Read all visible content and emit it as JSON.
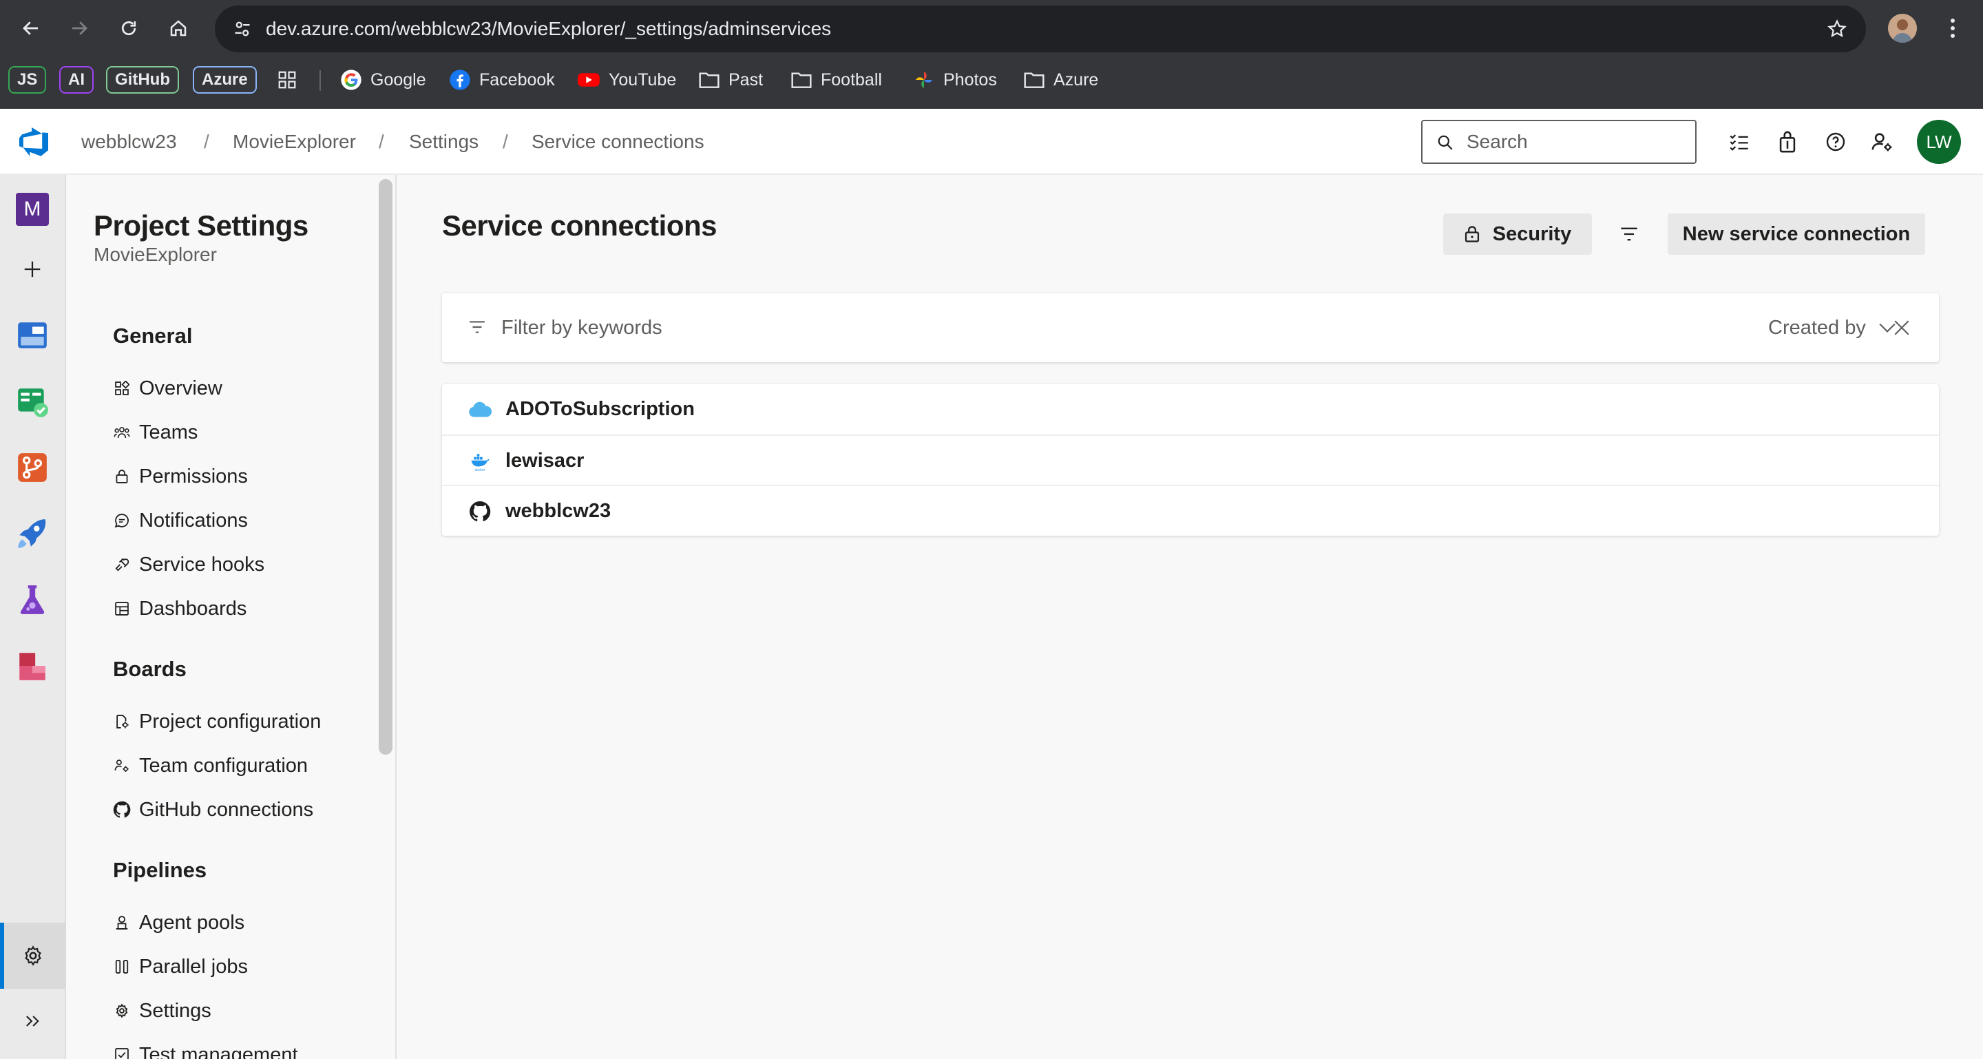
{
  "browser": {
    "url": "dev.azure.com/webblcw23/MovieExplorer/_settings/adminservices",
    "bookmarks": [
      {
        "label": "JS",
        "color": "#34a853"
      },
      {
        "label": "AI",
        "color": "#a142f4"
      },
      {
        "label": "GitHub",
        "color": "#81c995"
      },
      {
        "label": "Azure",
        "color": "#8ab4f8"
      }
    ],
    "links": [
      "Google",
      "Facebook",
      "YouTube",
      "Past",
      "Football",
      "Photos",
      "Azure"
    ]
  },
  "header": {
    "breadcrumbs": [
      "webblcw23",
      "MovieExplorer",
      "Settings",
      "Service connections"
    ],
    "breadcrumb_separator": "/",
    "search_placeholder": "Search",
    "avatar_initials": "LW"
  },
  "rail": {
    "project_initial": "M"
  },
  "settings_nav": {
    "title": "Project Settings",
    "subtitle": "MovieExplorer",
    "groups": [
      {
        "label": "General",
        "items": [
          "Overview",
          "Teams",
          "Permissions",
          "Notifications",
          "Service hooks",
          "Dashboards"
        ]
      },
      {
        "label": "Boards",
        "items": [
          "Project configuration",
          "Team configuration",
          "GitHub connections"
        ]
      },
      {
        "label": "Pipelines",
        "items": [
          "Agent pools",
          "Parallel jobs",
          "Settings",
          "Test management"
        ]
      }
    ]
  },
  "main": {
    "title": "Service connections",
    "security_label": "Security",
    "new_connection_label": "New service connection",
    "filter_placeholder": "Filter by keywords",
    "created_by_label": "Created by",
    "connections": [
      {
        "name": "ADOToSubscription",
        "icon": "azure-cloud-icon"
      },
      {
        "name": "lewisacr",
        "icon": "docker-icon"
      },
      {
        "name": "webblcw23",
        "icon": "github-icon"
      }
    ]
  },
  "colors": {
    "accent": "#0078d4",
    "project_tile": "#5c2d91",
    "avatar": "#0b6a2c"
  }
}
